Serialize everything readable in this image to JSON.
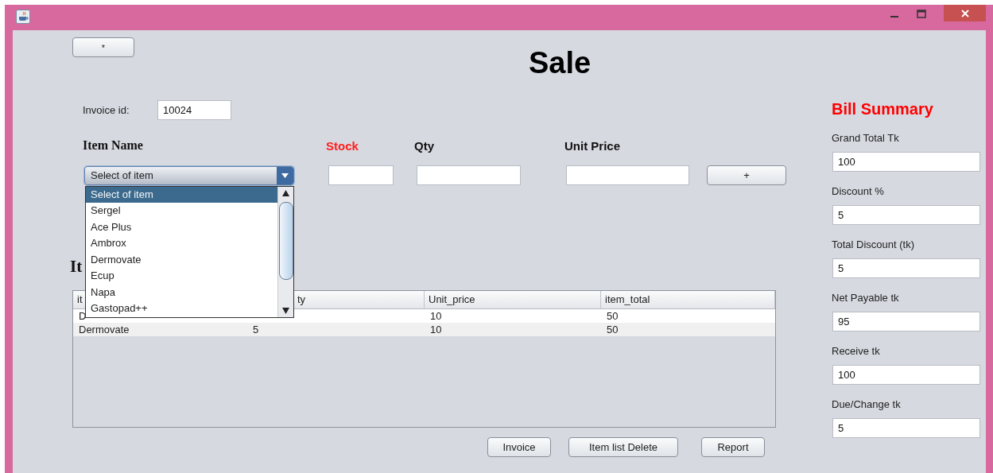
{
  "toolbar_button": "*",
  "title": "Sale",
  "invoice": {
    "label": "Invoice id:",
    "value": "10024"
  },
  "item_form": {
    "columns": [
      {
        "label": "Item Name",
        "kind": "combo",
        "highlight": false
      },
      {
        "label": "Stock",
        "kind": "field",
        "highlight": true
      },
      {
        "label": "Qty",
        "kind": "field",
        "highlight": false
      },
      {
        "label": "Unit Price",
        "kind": "field",
        "highlight": false
      }
    ],
    "combo": {
      "value": "Select of item",
      "expanded": true,
      "options": [
        {
          "label": "Select of item",
          "selected": true
        },
        {
          "label": "Sergel",
          "selected": false
        },
        {
          "label": "Ace Plus",
          "selected": false
        },
        {
          "label": "Ambrox",
          "selected": false
        },
        {
          "label": "Dermovate",
          "selected": false
        },
        {
          "label": "Ecup",
          "selected": false
        },
        {
          "label": "Napa",
          "selected": false
        },
        {
          "label": "Gastopad++",
          "selected": false
        }
      ]
    },
    "add_button": "+"
  },
  "items_heading": "It",
  "table": {
    "columns": [
      {
        "label": "it"
      },
      {
        "label": "ty"
      },
      {
        "label": "Unit_price"
      },
      {
        "label": "item_total"
      }
    ],
    "rows": [
      {
        "cells": [
          "D",
          null,
          "10",
          "50"
        ]
      },
      {
        "cells": [
          "Dermovate",
          "5",
          "10",
          "50"
        ]
      }
    ]
  },
  "buttons": [
    "Invoice",
    "Item list Delete",
    "Report"
  ],
  "summary": {
    "title": "Bill Summary",
    "fields": [
      {
        "label": "Grand Total Tk",
        "value": "100"
      },
      {
        "label": "Discount %",
        "value": "5"
      },
      {
        "label": "Total Discount (tk)",
        "value": "5"
      },
      {
        "label": "Net Payable tk",
        "value": "95"
      },
      {
        "label": "Receive tk",
        "value": "100"
      },
      {
        "label": "Due/Change tk",
        "value": "5"
      }
    ]
  }
}
